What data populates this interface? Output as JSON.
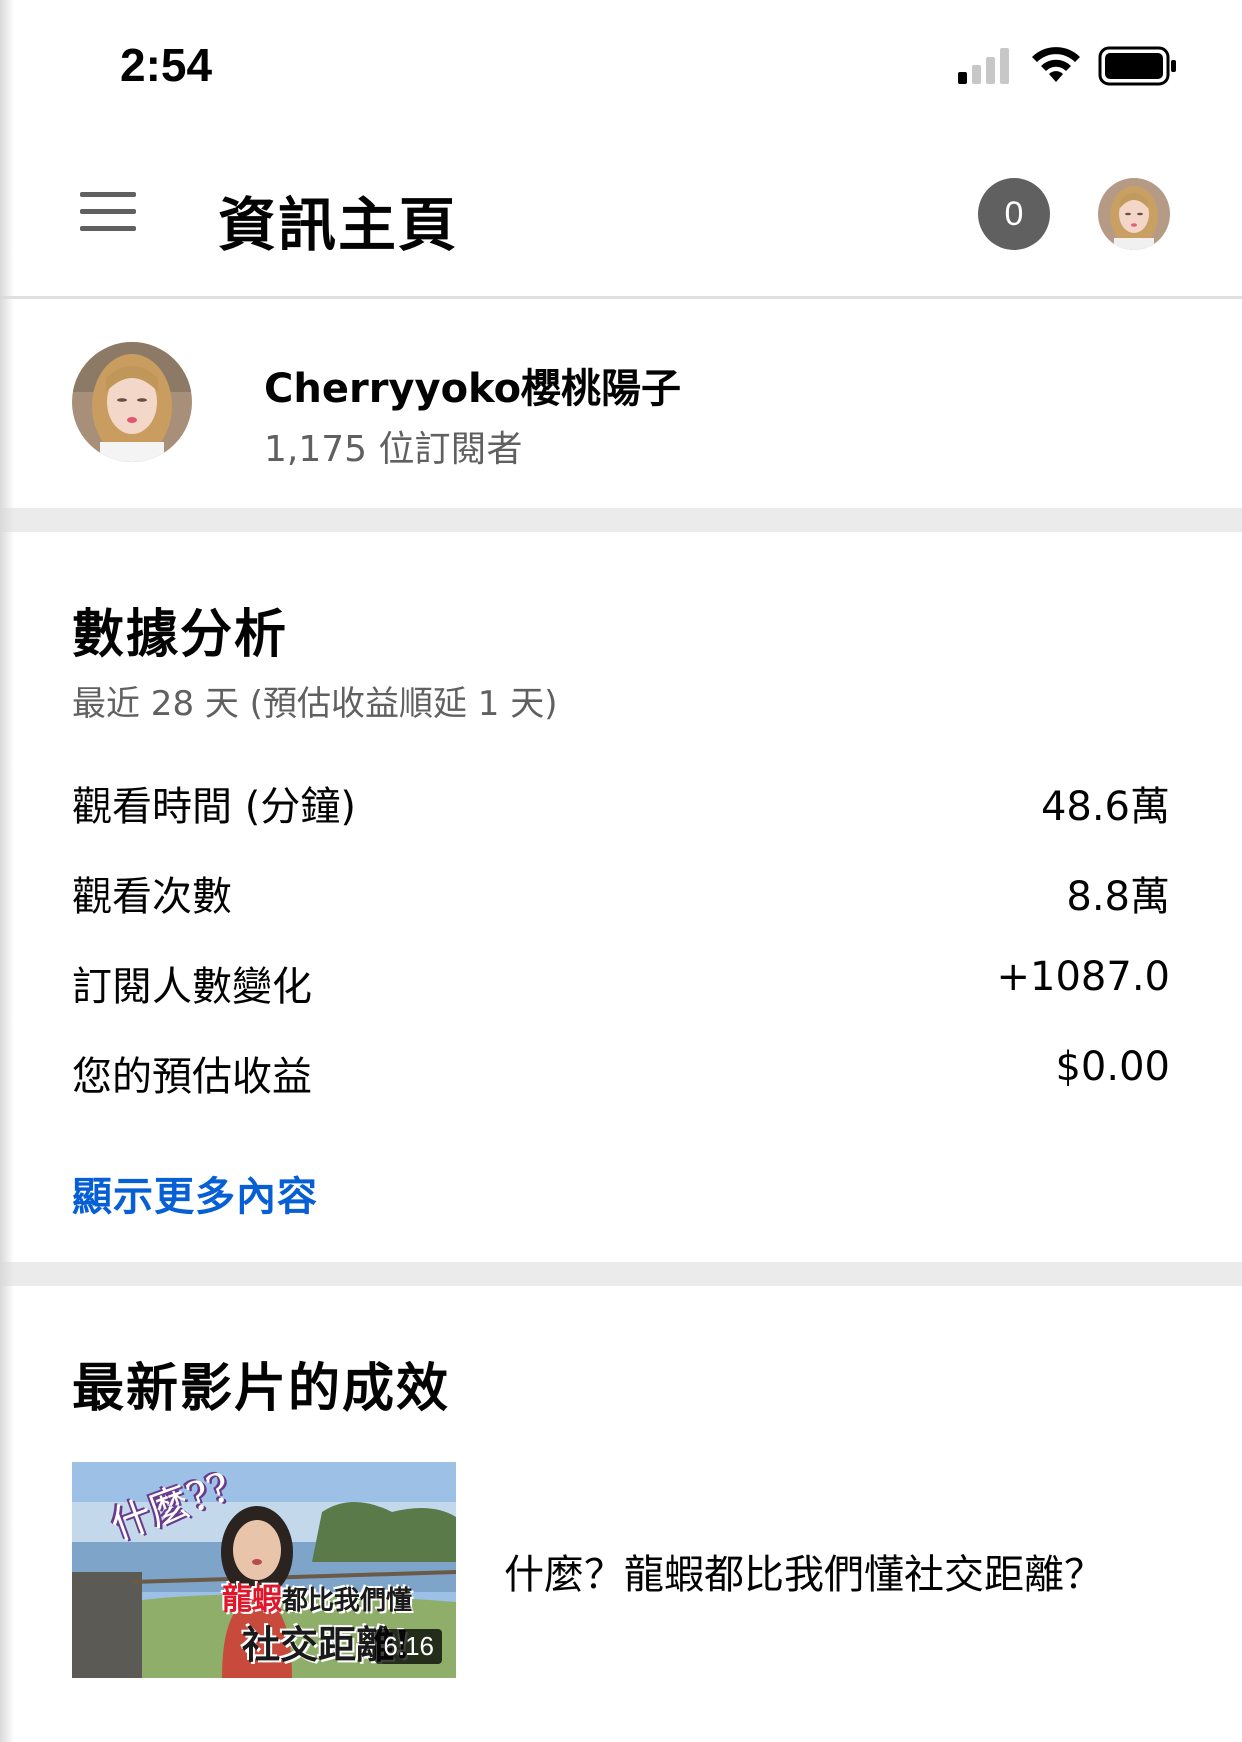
{
  "status_bar": {
    "time": "2:54"
  },
  "app_bar": {
    "title": "資訊主頁",
    "notification_count": "0"
  },
  "channel": {
    "name": "Cherryyoko櫻桃陽子",
    "subscribers": "1,175 位訂閱者"
  },
  "analytics": {
    "title": "數據分析",
    "subtitle": "最近 28 天 (預估收益順延 1 天)",
    "metrics": [
      {
        "label": "觀看時間 (分鐘)",
        "value": "48.6萬"
      },
      {
        "label": "觀看次數",
        "value": "8.8萬"
      },
      {
        "label": "訂閱人數變化",
        "value": "+1087.0"
      },
      {
        "label": "您的預估收益",
        "value": "$0.00"
      }
    ],
    "show_more": "顯示更多內容"
  },
  "latest_video": {
    "section_title": "最新影片的成效",
    "title": "什麼？龍蝦都比我們懂社交距離？",
    "duration": "6:16",
    "thumb_text_top": "什麼??",
    "thumb_text_red": "龍蝦",
    "thumb_text_line1": "都比我們懂",
    "thumb_text_line2": "社交距離!"
  },
  "colors": {
    "link": "#065fd4",
    "badge": "#606060",
    "divider": "#ebebeb"
  }
}
